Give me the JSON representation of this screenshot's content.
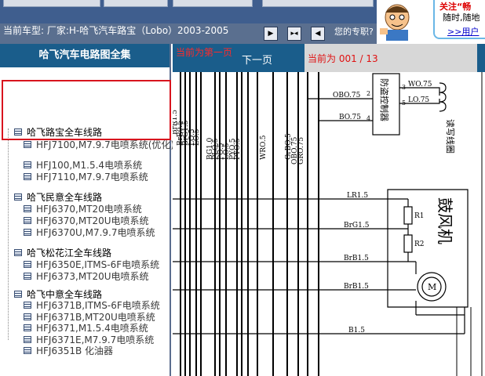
{
  "header": {
    "car_label": "当前车型:  厂家:H-哈飞汽车路宝（Lobo）2003-2005",
    "contact_label": "您的专职?"
  },
  "ad": {
    "line1": "关注“畅",
    "line2": "随时,随地",
    "line3": ">>用户"
  },
  "sidebar": {
    "title": "哈飞汽车电路图全集",
    "groups": [
      {
        "name": "哈飞路宝全车线路",
        "items": [
          "HFJ7100,M7.9.7电喷系统(优化)",
          "HFJ100,M1.5.4电喷系统",
          "HFJ7110,M7.9.7电喷系统"
        ]
      },
      {
        "name": "哈飞民意全车线路",
        "items": [
          "HFJ6370,MT20电喷系统",
          "HFJ6370,MT20U电喷系统",
          "HFJ6370U,M7.9.7电喷系统"
        ]
      },
      {
        "name": "哈飞松花江全车线路",
        "items": [
          "HFJ6350E,ITMS-6F电喷系统",
          "HFJ6373,MT20U电喷系统"
        ]
      },
      {
        "name": "哈飞中意全车线路",
        "items": [
          "HFJ6371B,ITMS-6F电喷系统",
          "HFJ6371B,MT20U电喷系统",
          "HFJ6371,M1.5.4电喷系统",
          "HFJ6371E,M7.9.7电喷系统",
          "HFJ6351B 化油器"
        ]
      }
    ]
  },
  "diagram_nav": {
    "prev_label": "当前为第一页",
    "next_label": "下一页",
    "page_label": "当前为 001 / 13"
  },
  "diagram": {
    "vertical_labels": [
      "BrR1.5",
      "BrR0.5",
      "BrG1.5",
      "LO.5",
      "LO.5",
      "BG1.0",
      "PLO.5",
      "PO.5",
      "LO.5",
      "PYO.5",
      "PYO.5",
      "WRO.5",
      "GrBO.5",
      "OBO.75",
      "GRO.75"
    ],
    "wire_labels": [
      "OBO.75",
      "BO.75",
      "WO.75",
      "LO.75",
      "LR1.5",
      "BrG1.5",
      "BrB1.5",
      "BrB1.5",
      "B1.5"
    ],
    "pin_labels": [
      "2",
      "3",
      "5",
      "4"
    ],
    "components": [
      "防盗控制器",
      "读写线圈",
      "鼓风机",
      "R1",
      "R2",
      "M"
    ]
  }
}
